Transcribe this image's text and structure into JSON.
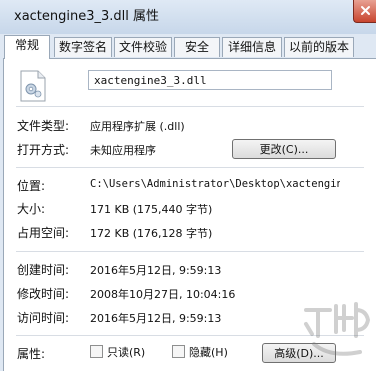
{
  "window": {
    "title": "xactengine3_3.dll 属性"
  },
  "tabs": [
    {
      "label": "常规",
      "active": true
    },
    {
      "label": "数字签名",
      "active": false
    },
    {
      "label": "文件校验",
      "active": false
    },
    {
      "label": "安全",
      "active": false
    },
    {
      "label": "详细信息",
      "active": false
    },
    {
      "label": "以前的版本",
      "active": false
    }
  ],
  "file": {
    "icon": "dll-file-icon",
    "name": "xactengine3_3.dll"
  },
  "properties": {
    "type_label": "文件类型:",
    "type_value": "应用程序扩展 (.dll)",
    "open_label": "打开方式:",
    "open_value": "未知应用程序",
    "change_button": "更改(C)...",
    "location_label": "位置:",
    "location_value": "C:\\Users\\Administrator\\Desktop\\xactengine",
    "size_label": "大小:",
    "size_value": "171 KB (175,440 字节)",
    "disk_label": "占用空间:",
    "disk_value": "172 KB (176,128 字节)",
    "created_label": "创建时间:",
    "created_value": "2016年5月12日, 9:59:13",
    "modified_label": "修改时间:",
    "modified_value": "2008年10月27日, 10:04:16",
    "accessed_label": "访问时间:",
    "accessed_value": "2016年5月12日, 9:59:13",
    "attributes_label": "属性:",
    "readonly_label": "只读(R)",
    "hidden_label": "隐藏(H)",
    "advanced_button": "高级(D)..."
  },
  "colors": {
    "window_bg": "#dfe8f3",
    "panel_bg": "#ffffff",
    "close_button": "#c8452f"
  }
}
